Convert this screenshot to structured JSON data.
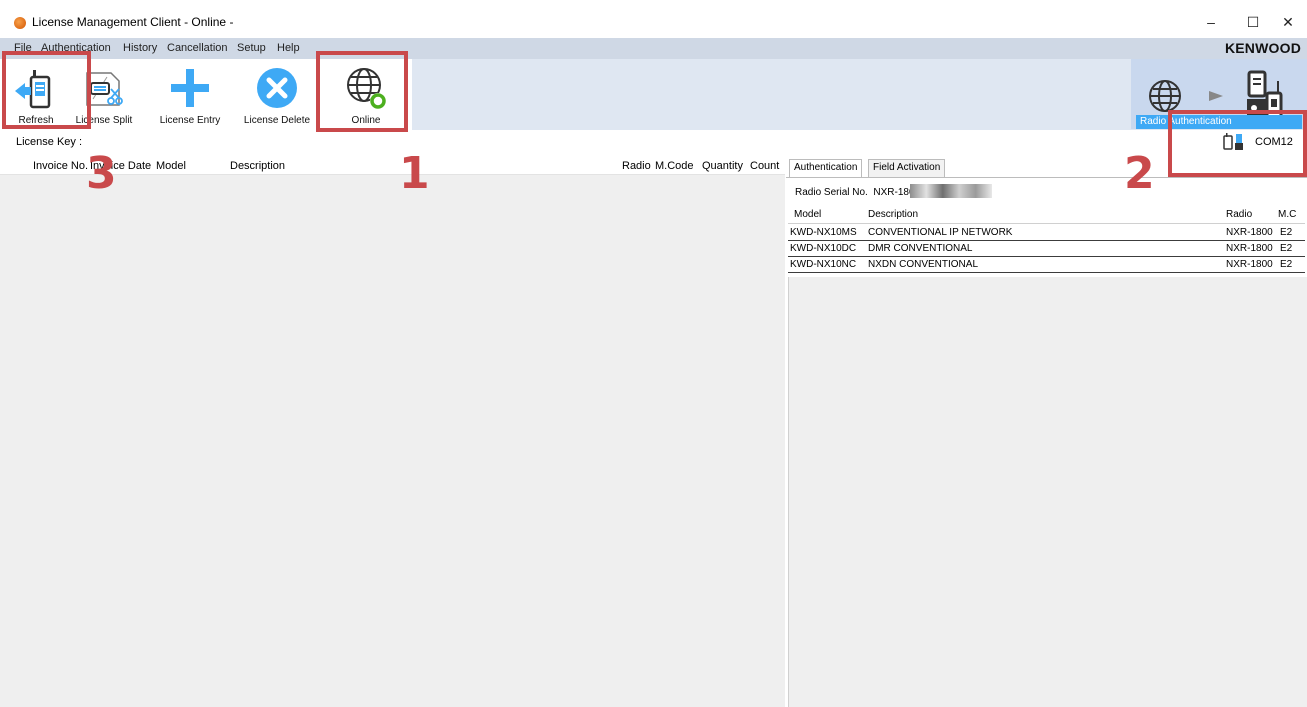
{
  "window": {
    "title": "License Management Client - Online -",
    "controls": {
      "minimize": "–",
      "maximize": "☐",
      "close": "✕"
    }
  },
  "menu": {
    "items": [
      {
        "label": "File"
      },
      {
        "label": "Authentication"
      },
      {
        "label": "History"
      },
      {
        "label": "Cancellation"
      },
      {
        "label": "Setup"
      },
      {
        "label": "Help"
      }
    ],
    "brand": "KENWOOD"
  },
  "toolbar": {
    "refresh": "Refresh",
    "license_split": "License Split",
    "license_entry": "License Entry",
    "license_delete": "License Delete",
    "online": "Online",
    "radio_authentication": "Radio Authentication"
  },
  "annotations": {
    "one": "1",
    "two": "2",
    "three": "3"
  },
  "license_key_label": "License Key   :",
  "com_port": "COM12",
  "left_table": {
    "columns": [
      "Invoice No.",
      "Invoice Date",
      "Model",
      "Description",
      "Radio",
      "M.Code",
      "Quantity",
      "Count"
    ]
  },
  "right_panel": {
    "tabs": [
      "Authentication",
      "Field Activation"
    ],
    "serial_label": "Radio Serial No.",
    "serial_value": "NXR-1800/",
    "columns": [
      "Model",
      "Description",
      "Radio",
      "M.C"
    ],
    "rows": [
      {
        "model": "KWD-NX10MS",
        "description": "CONVENTIONAL IP NETWORK",
        "radio": "NXR-1800",
        "mcode": "E2"
      },
      {
        "model": "KWD-NX10DC",
        "description": "DMR CONVENTIONAL",
        "radio": "NXR-1800",
        "mcode": "E2"
      },
      {
        "model": "KWD-NX10NC",
        "description": "NXDN CONVENTIONAL",
        "radio": "NXR-1800",
        "mcode": "E2"
      }
    ]
  },
  "colors": {
    "highlight": "#c9494b",
    "accent": "#3ea9f5",
    "online_ring": "#4caf1f"
  }
}
